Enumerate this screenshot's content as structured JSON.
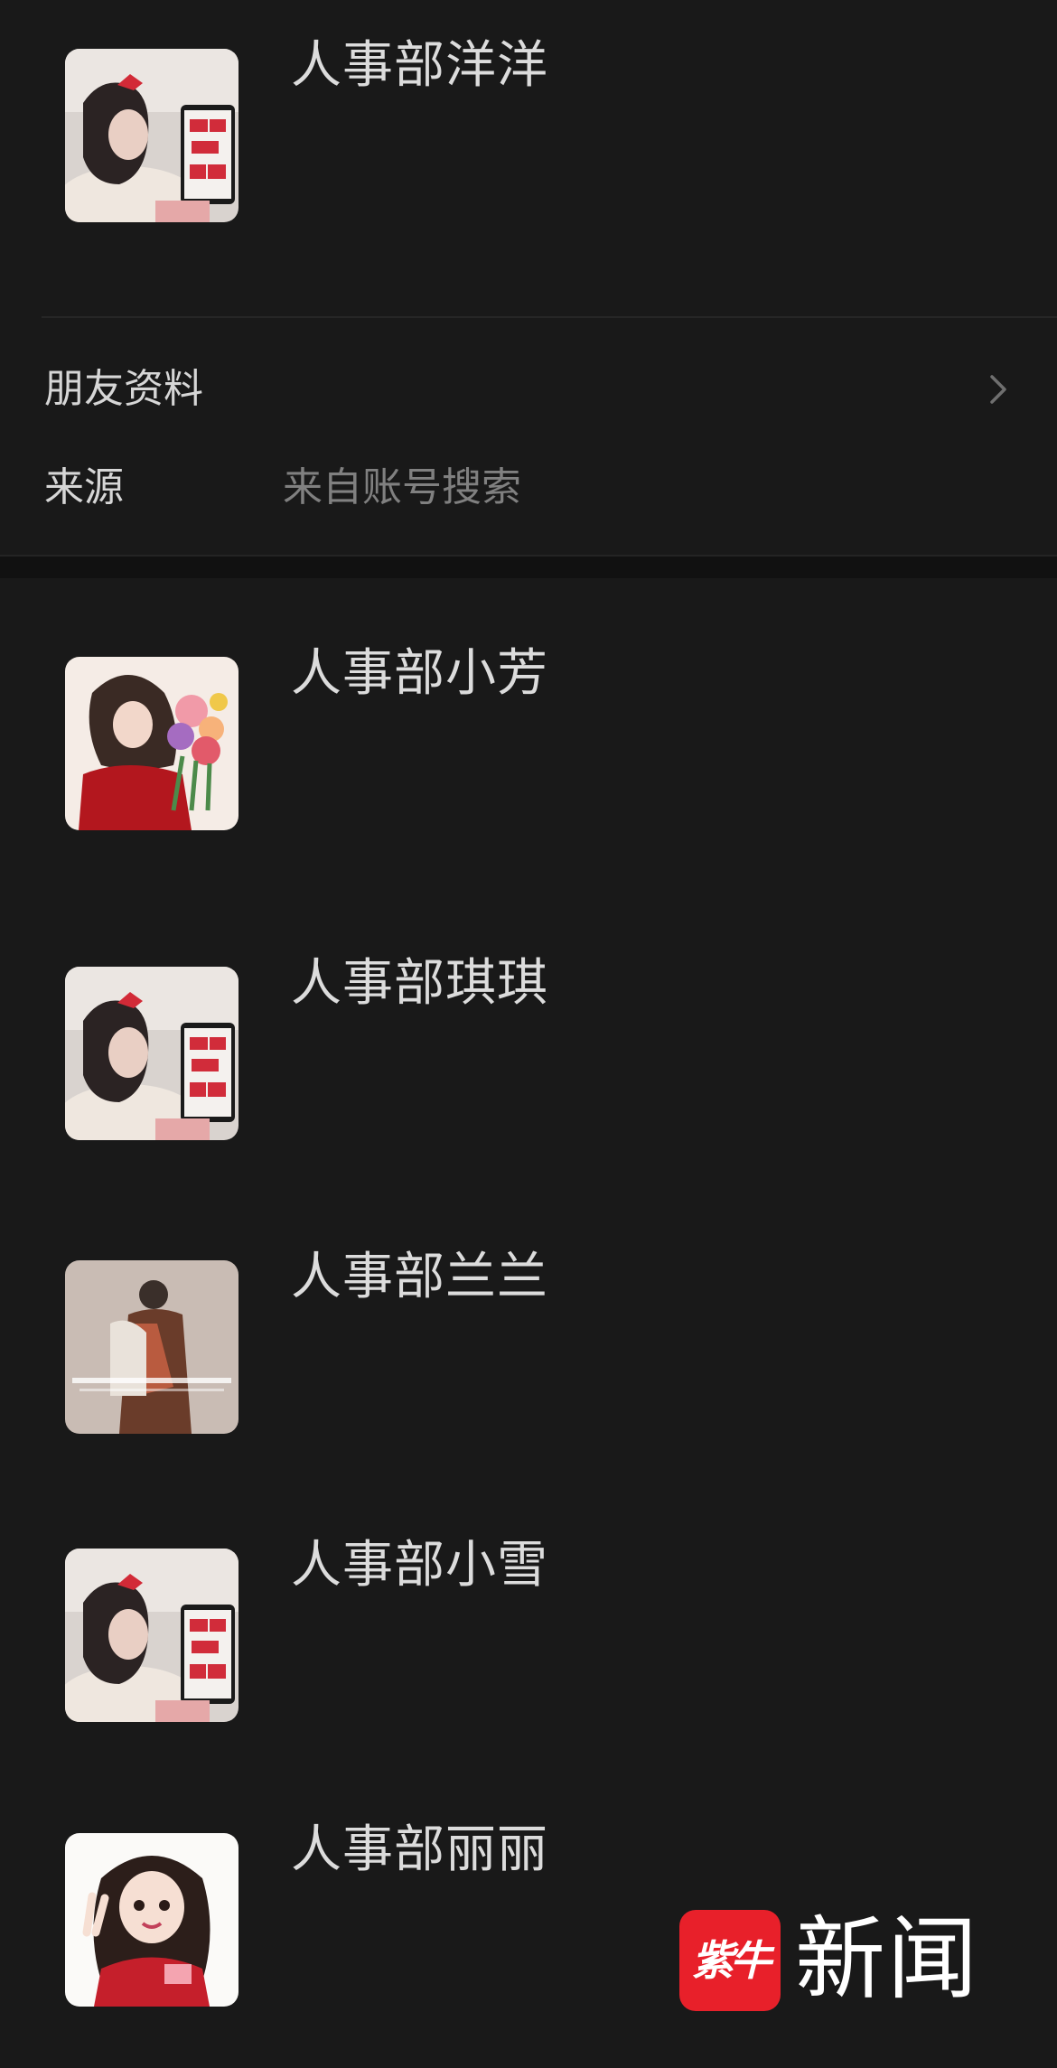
{
  "profile": {
    "name": "人事部洋洋",
    "rows": [
      {
        "label": "朋友资料",
        "value": ""
      },
      {
        "label": "来源",
        "value": "来自账号搜索"
      }
    ]
  },
  "list": [
    {
      "name": "人事部小芳",
      "avatar": "avatar-girl-flowers"
    },
    {
      "name": "人事部琪琪",
      "avatar": "avatar-girl-tablet"
    },
    {
      "name": "人事部兰兰",
      "avatar": "avatar-couple"
    },
    {
      "name": "人事部小雪",
      "avatar": "avatar-girl-tablet"
    },
    {
      "name": "人事部丽丽",
      "avatar": "avatar-cartoon-girl"
    }
  ],
  "watermark": {
    "logo_text": "紫牛",
    "text": "新闻"
  },
  "colors": {
    "background": "#191919",
    "name_text": "#dcdcdc",
    "secondary_text": "#808080",
    "watermark_red": "#e8202a"
  }
}
